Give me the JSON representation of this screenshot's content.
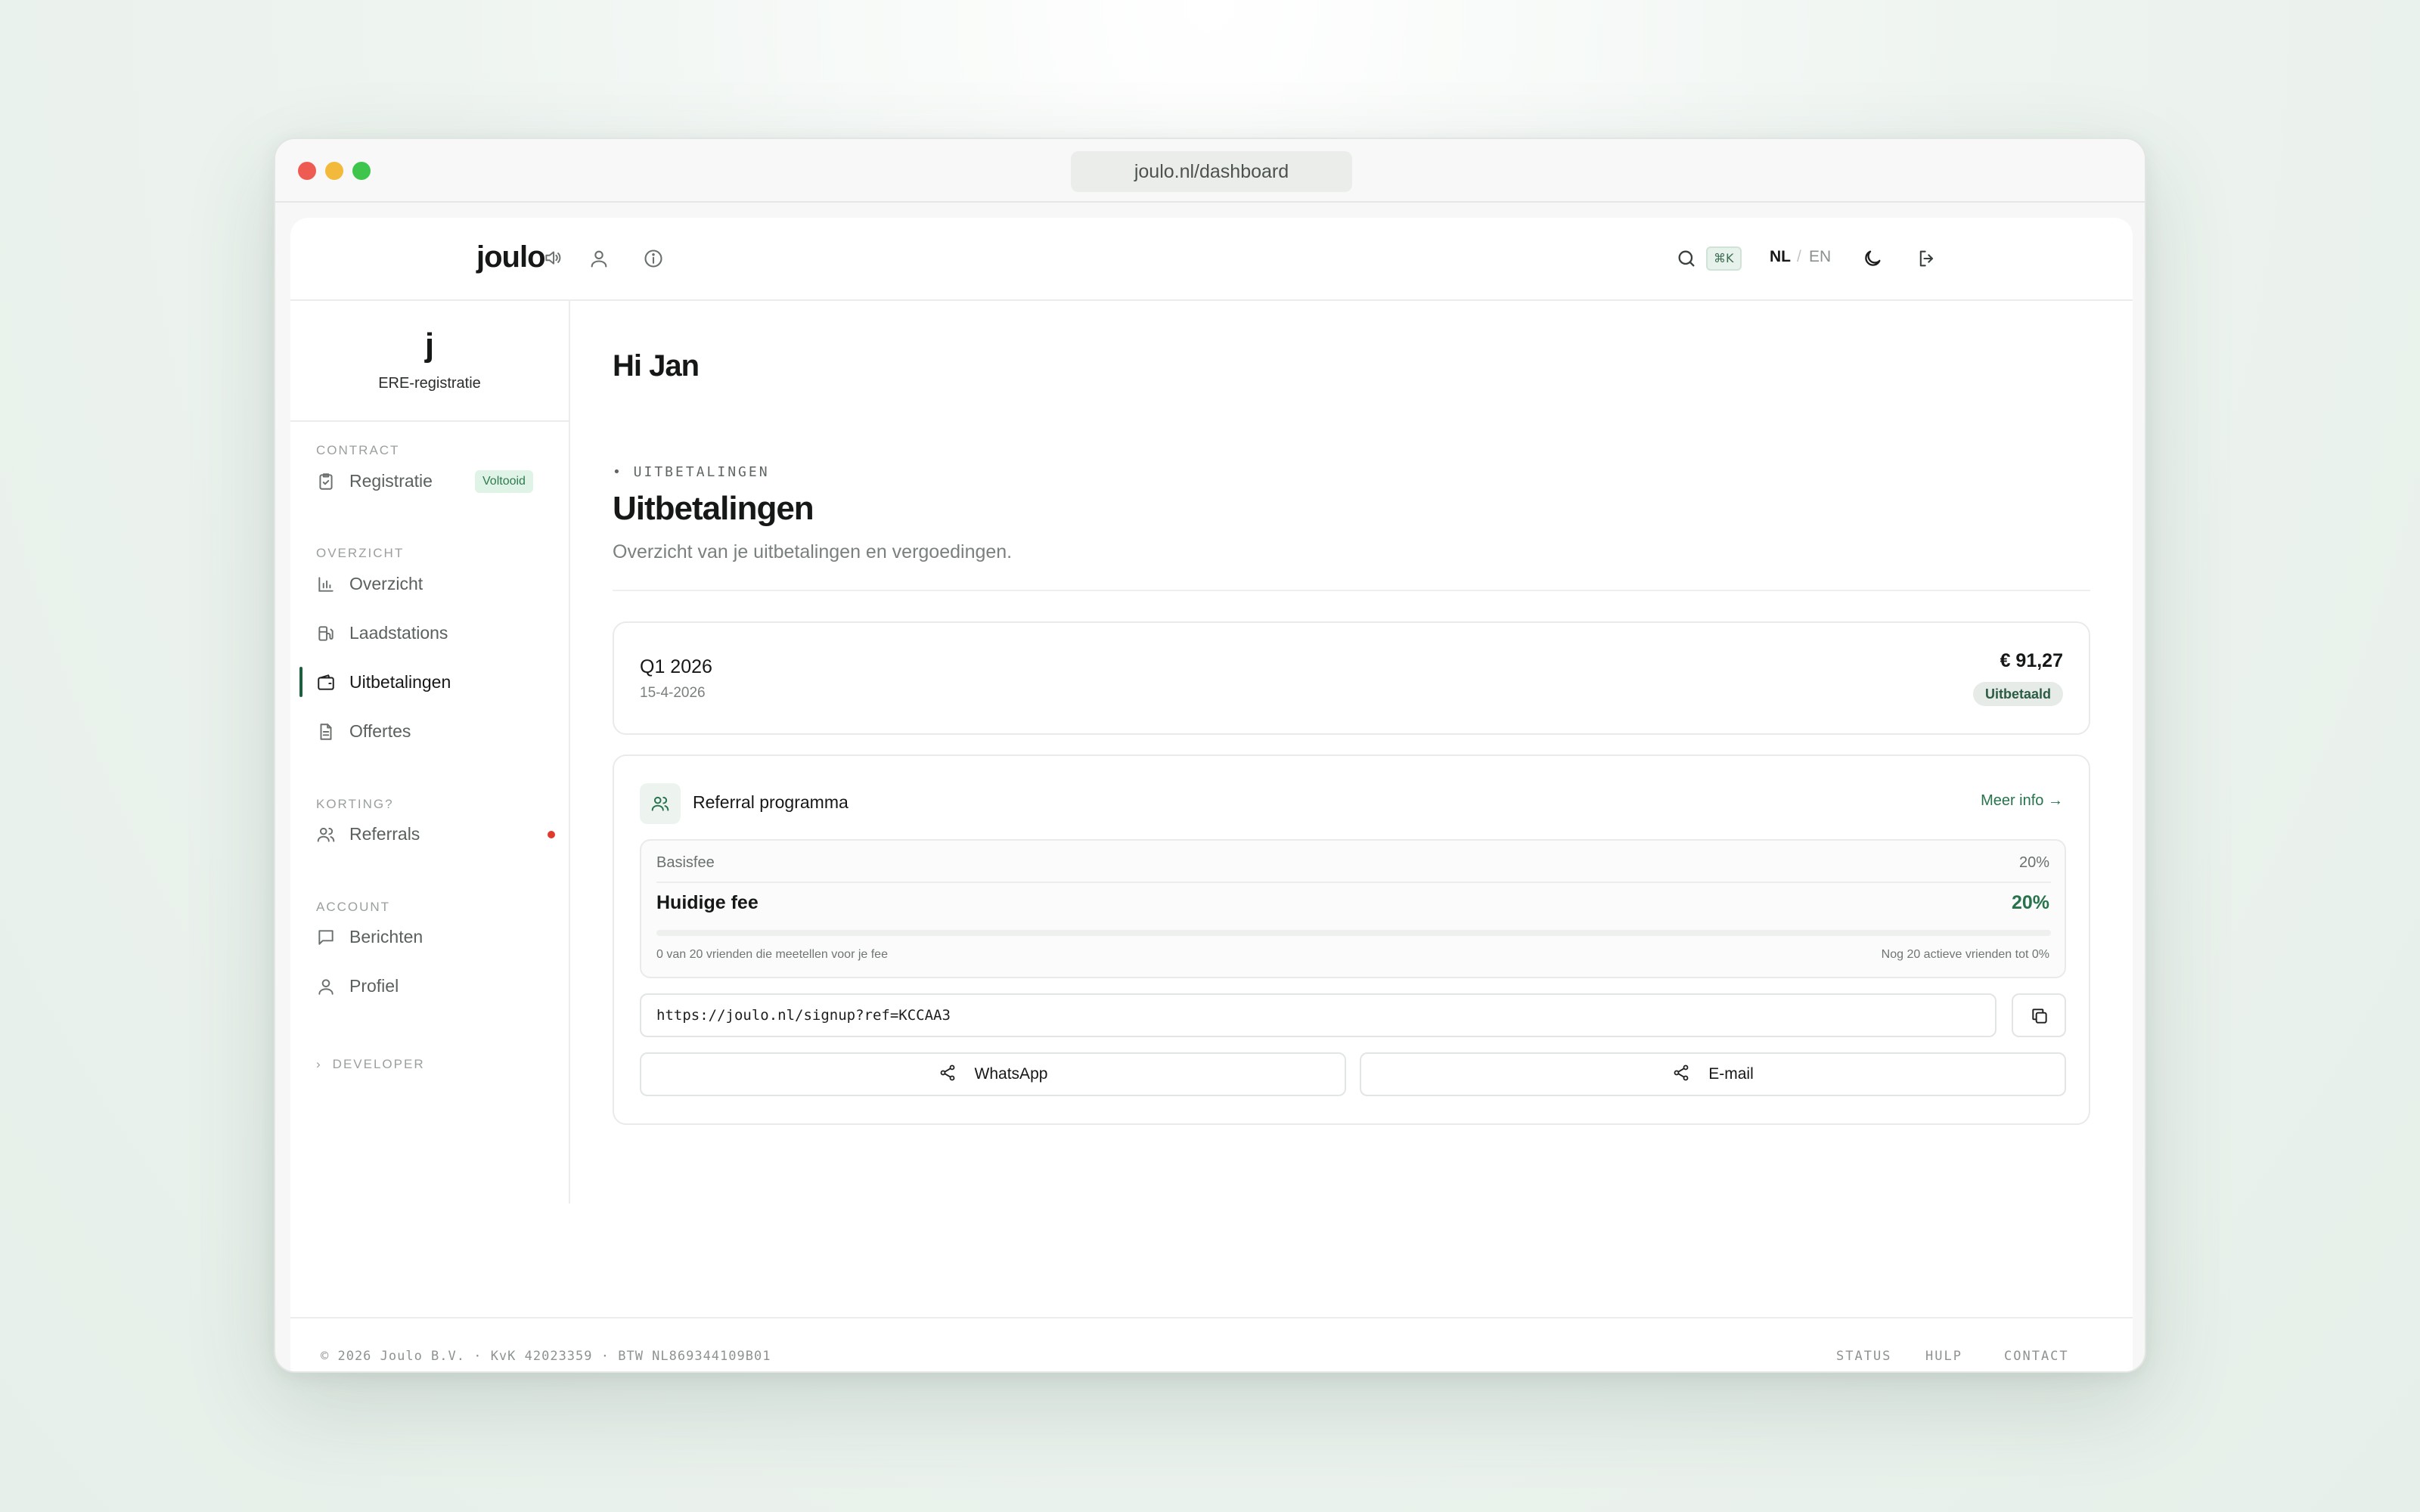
{
  "browser": {
    "url": "joulo.nl/dashboard"
  },
  "topnav": {
    "logo": "joulo",
    "shortcut": "⌘K",
    "lang_active": "NL",
    "lang_separator": "/",
    "lang_other": "EN",
    "icons": [
      "speaker-icon",
      "user-icon",
      "info-icon",
      "search-icon",
      "moon-icon",
      "logout-icon"
    ]
  },
  "sidebar": {
    "brand_mark": "j",
    "brand_subtitle": "ERE-registratie",
    "sections": {
      "contract": "CONTRACT",
      "overview": "OVERZICHT",
      "discount": "KORTING?",
      "account": "ACCOUNT"
    },
    "items": {
      "registratie": "Registratie",
      "registratie_badge": "Voltooid",
      "overzicht": "Overzicht",
      "laadstations": "Laadstations",
      "uitbetalingen": "Uitbetalingen",
      "offertes": "Offertes",
      "referrals": "Referrals",
      "berichten": "Berichten",
      "profiel": "Profiel"
    },
    "developer": "DEVELOPER",
    "accent_color": "#1f5f40"
  },
  "main": {
    "greeting": "Hi Jan",
    "eyebrow": "• UITBETALINGEN",
    "title": "Uitbetalingen",
    "description": "Overzicht van je uitbetalingen en vergoedingen.",
    "payout": {
      "period": "Q1 2026",
      "date": "15-4-2026",
      "amount": "€ 91,27",
      "status": "Uitbetaald"
    },
    "referral": {
      "title": "Referral programma",
      "more_link": "Meer info →",
      "base_fee_label": "Basisfee",
      "base_fee_value": "20%",
      "current_fee_label": "Huidige fee",
      "current_fee_value": "20%",
      "progress_fraction": 0,
      "progress_note": "0 van 20 vrienden die meetellen voor je fee",
      "remaining_note": "Nog 20 actieve vrienden tot 0%",
      "link": "https://joulo.nl/signup?ref=KCCAA3",
      "share_whatsapp": "WhatsApp",
      "share_email": "E-mail",
      "accent_color": "#26734c"
    }
  },
  "footer": {
    "copyright": "© 2026 Joulo B.V. · KvK 42023359 · BTW NL869344109B01",
    "links": {
      "status": "STATUS",
      "help": "HULP",
      "contact": "CONTACT"
    }
  }
}
